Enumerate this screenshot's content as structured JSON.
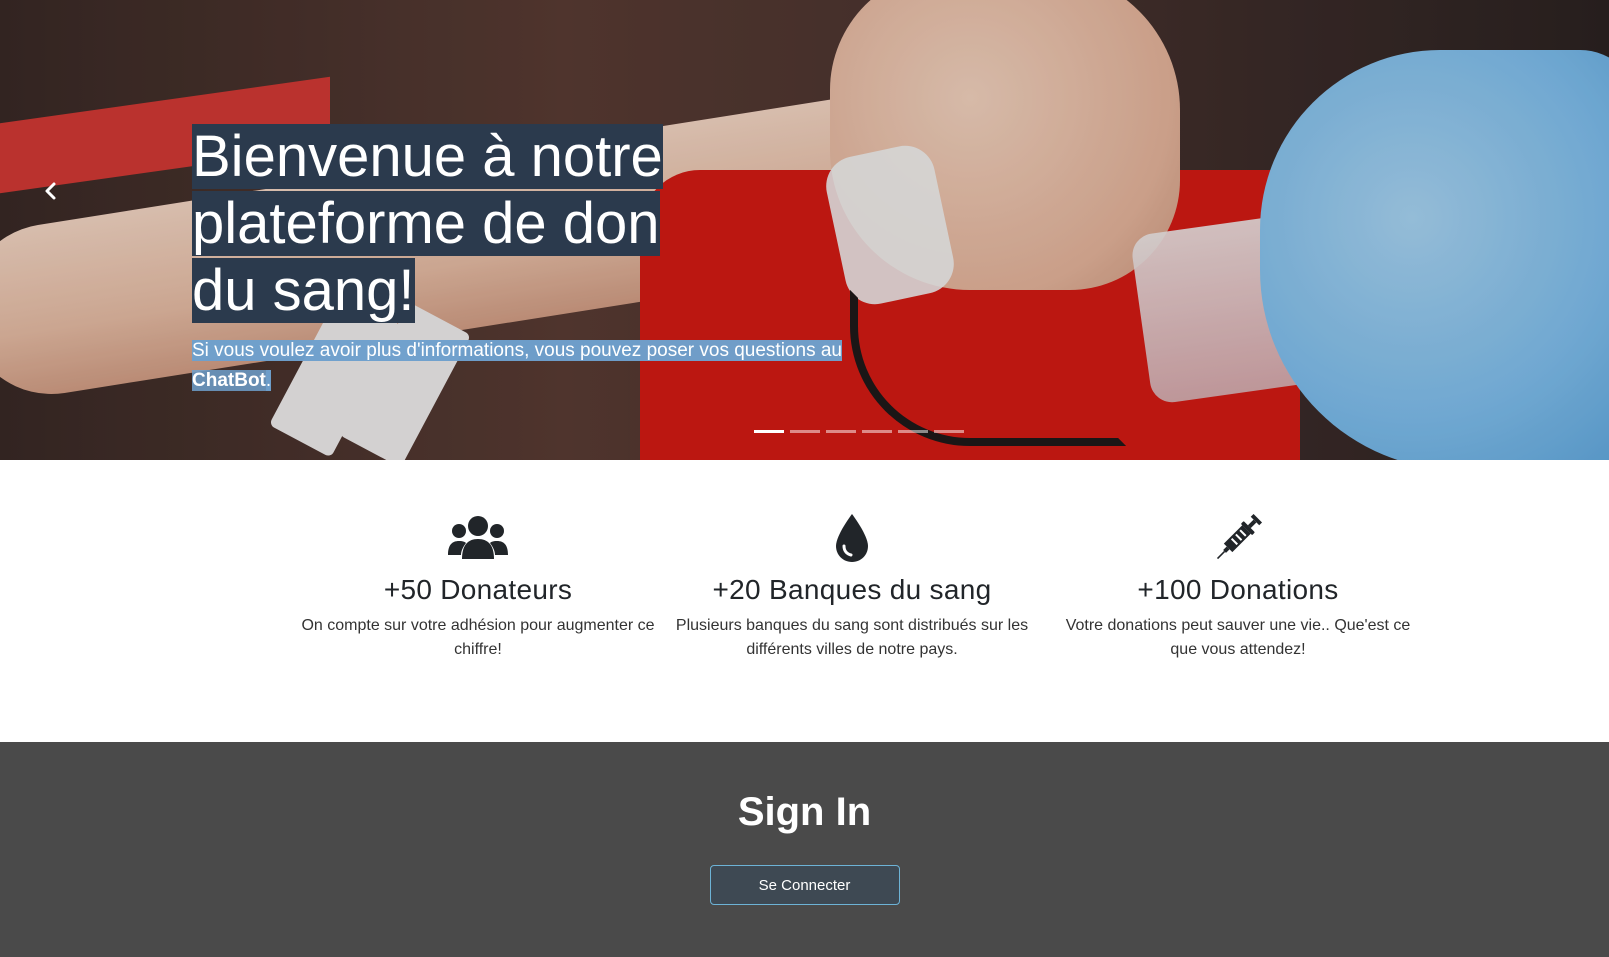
{
  "hero": {
    "title": "Bienvenue à notre plateforme de don du sang!",
    "subtitle_text": "Si vous voulez avoir plus d'informations, vous pouvez poser vos questions au ",
    "subtitle_link": "ChatBot",
    "subtitle_end": ".",
    "prev_icon": "chevron-left-icon",
    "slide_count": 6,
    "active_slide": 1
  },
  "stats": [
    {
      "icon": "users-icon",
      "title": "+50 Donateurs",
      "text": "On compte sur votre adhésion pour augmenter ce chiffre!"
    },
    {
      "icon": "blood-drop-icon",
      "title": "+20 Banques du sang",
      "text": "Plusieurs banques du sang sont distribués sur les différents villes de notre pays."
    },
    {
      "icon": "syringe-icon",
      "title": "+100 Donations",
      "text": "Votre donations peut sauver une vie.. Que'est ce que vous attendez!"
    }
  ],
  "signin": {
    "title": "Sign In",
    "button_label": "Se Connecter"
  },
  "colors": {
    "caption_title_bg": "#2b3a4d",
    "caption_sub_bg": "#6ea0cd",
    "signin_bg": "#4a4a4a",
    "button_bg": "#3e4953",
    "button_border": "#6db3d6"
  }
}
